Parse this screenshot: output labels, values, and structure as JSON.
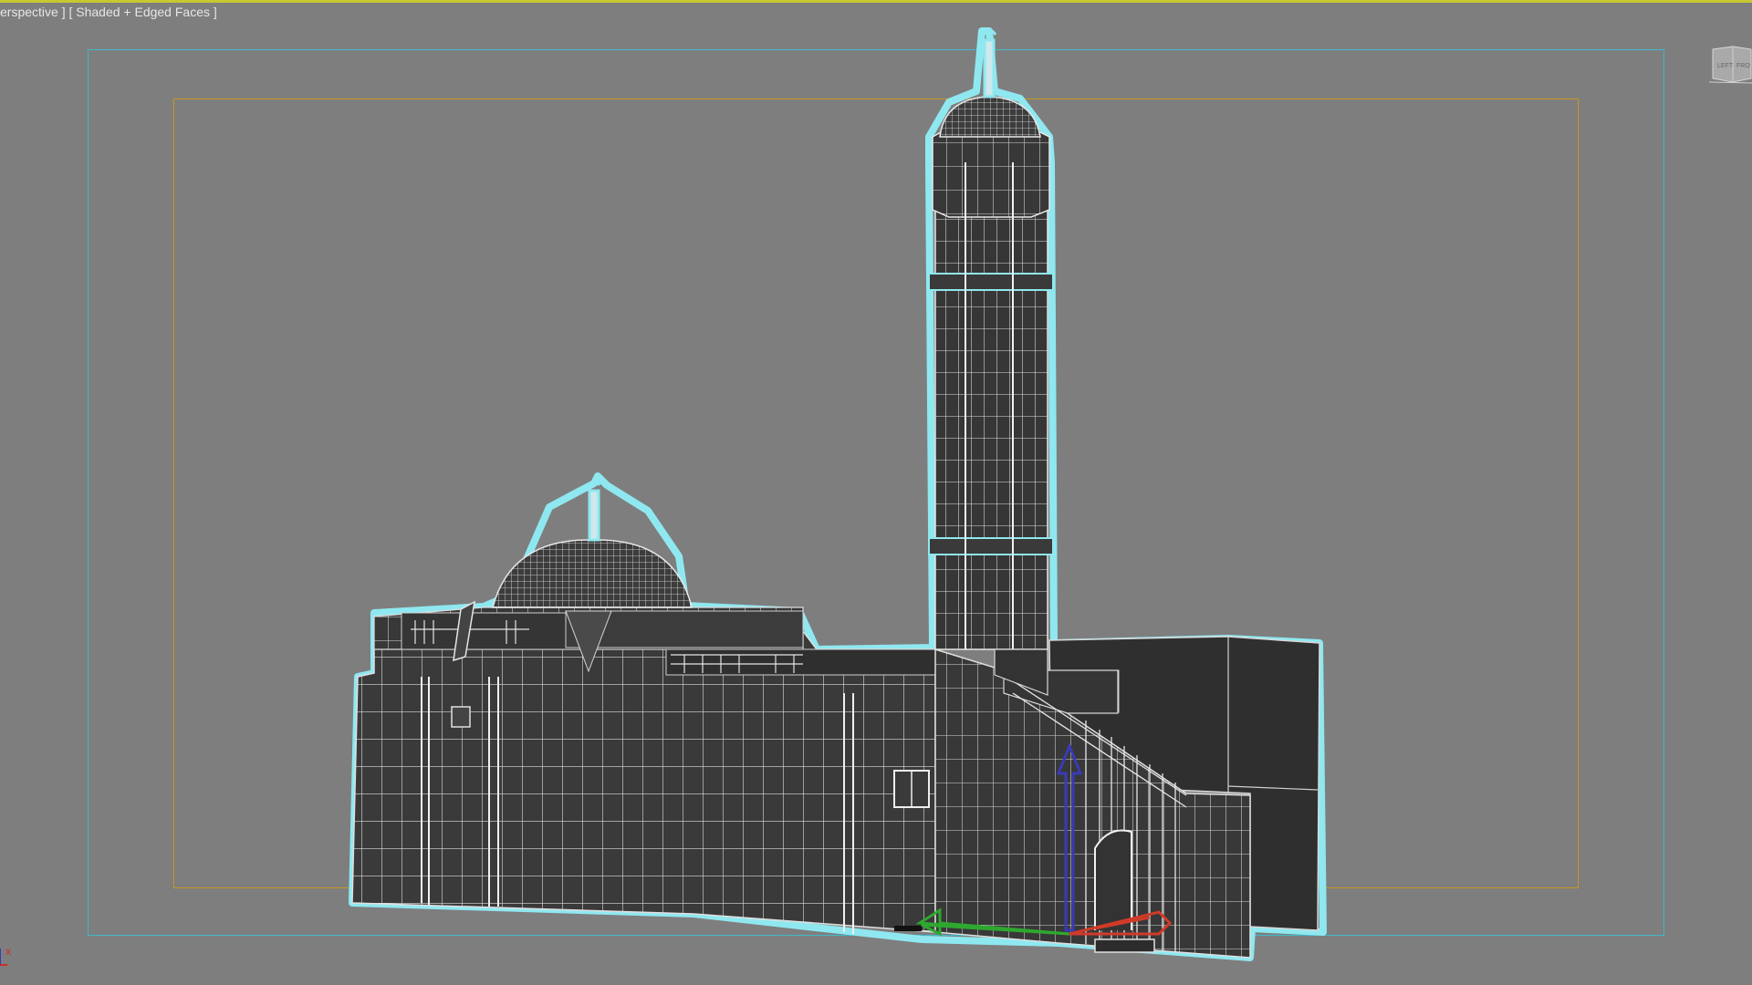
{
  "viewport": {
    "label_view": "erspective ]",
    "label_open_bracket": "[",
    "label_shading": "[ Shaded + Edged Faces ]",
    "viewcube_left": "LEFT",
    "viewcube_front": "FRO",
    "axis_x_label": "x"
  },
  "colors": {
    "background": "#7e7e7e",
    "active_viewport_border": "#c8c832",
    "safe_frame_outer": "#3fb8c8",
    "safe_frame_inner": "#c8961e",
    "mesh_fill": "#3a3a3a",
    "mesh_edges": "#e8e8e8",
    "selection_outline": "#8fe8f0",
    "gizmo_x": "#d03a2a",
    "gizmo_y": "#2ea82e",
    "gizmo_z": "#3a3ab8"
  },
  "icons": {
    "viewcube": "viewcube-icon",
    "axis_tripod": "axis-tripod-icon",
    "move_gizmo": "move-gizmo-icon"
  }
}
